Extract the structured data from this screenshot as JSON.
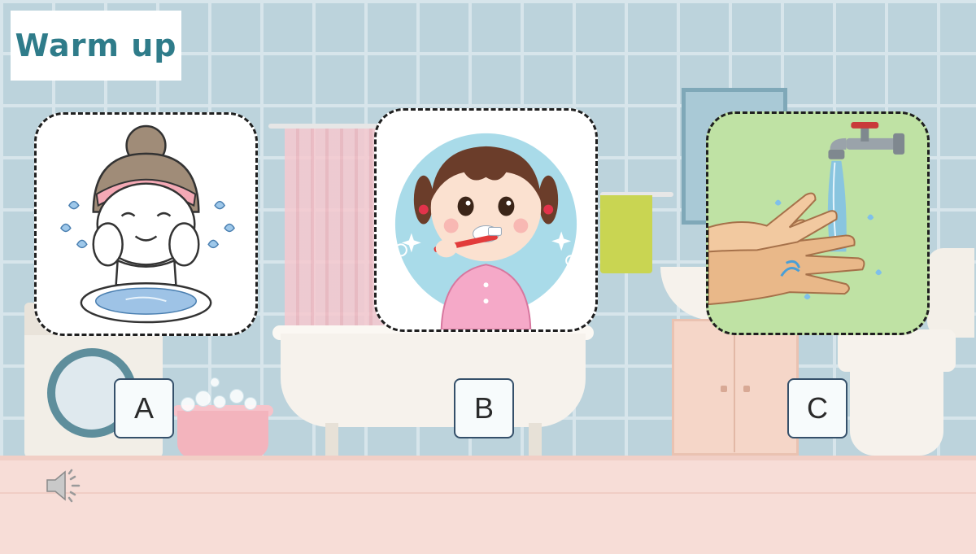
{
  "slide": {
    "title": "Warm up",
    "cards": [
      {
        "id": "A",
        "image": "girl-washing-face-icon",
        "option_label": "A"
      },
      {
        "id": "B",
        "image": "girl-brushing-teeth-icon",
        "option_label": "B"
      },
      {
        "id": "C",
        "image": "washing-hands-icon",
        "option_label": "C"
      }
    ],
    "audio": {
      "icon": "speaker-icon"
    }
  },
  "colors": {
    "title_text": "#2f7c8a",
    "card_border": "#1f1f1f",
    "option_border": "#35506a",
    "wall_tile": "#bcd3dc",
    "floor": "#f7ddd7"
  }
}
